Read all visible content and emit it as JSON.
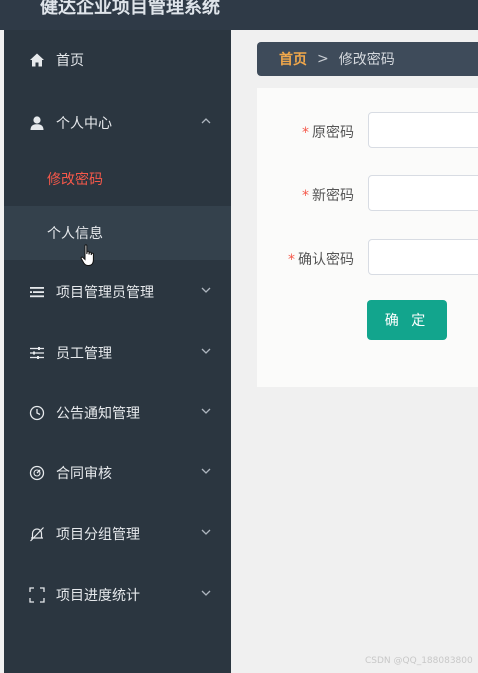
{
  "app": {
    "title": "健达企业项目管理系统"
  },
  "sidebar": {
    "items": [
      {
        "label": "首页",
        "icon": "home-icon"
      },
      {
        "label": "个人中心",
        "icon": "user-icon",
        "expanded": true,
        "children": [
          {
            "label": "修改密码",
            "active": true
          },
          {
            "label": "个人信息",
            "hover": true
          }
        ]
      },
      {
        "label": "项目管理员管理",
        "icon": "list-icon"
      },
      {
        "label": "员工管理",
        "icon": "sliders-icon"
      },
      {
        "label": "公告通知管理",
        "icon": "clock-icon"
      },
      {
        "label": "合同审核",
        "icon": "gauge-icon"
      },
      {
        "label": "项目分组管理",
        "icon": "bell-off-icon"
      },
      {
        "label": "项目进度统计",
        "icon": "fullscreen-icon"
      }
    ]
  },
  "breadcrumb": {
    "home": "首页",
    "separator": ">",
    "current": "修改密码"
  },
  "form": {
    "required_mark": "*",
    "old_password_label": "原密码",
    "new_password_label": "新密码",
    "confirm_password_label": "确认密码",
    "old_password_value": "",
    "new_password_value": "",
    "confirm_password_value": "",
    "submit_label": "确 定"
  },
  "watermark": "CSDN @QQ_188083800",
  "colors": {
    "sidebar_bg": "#2b3640",
    "topbar_bg": "#2f3a47",
    "active_item": "#f5584a",
    "breadcrumb_home": "#f0a74b",
    "primary_button": "#12a58d"
  }
}
